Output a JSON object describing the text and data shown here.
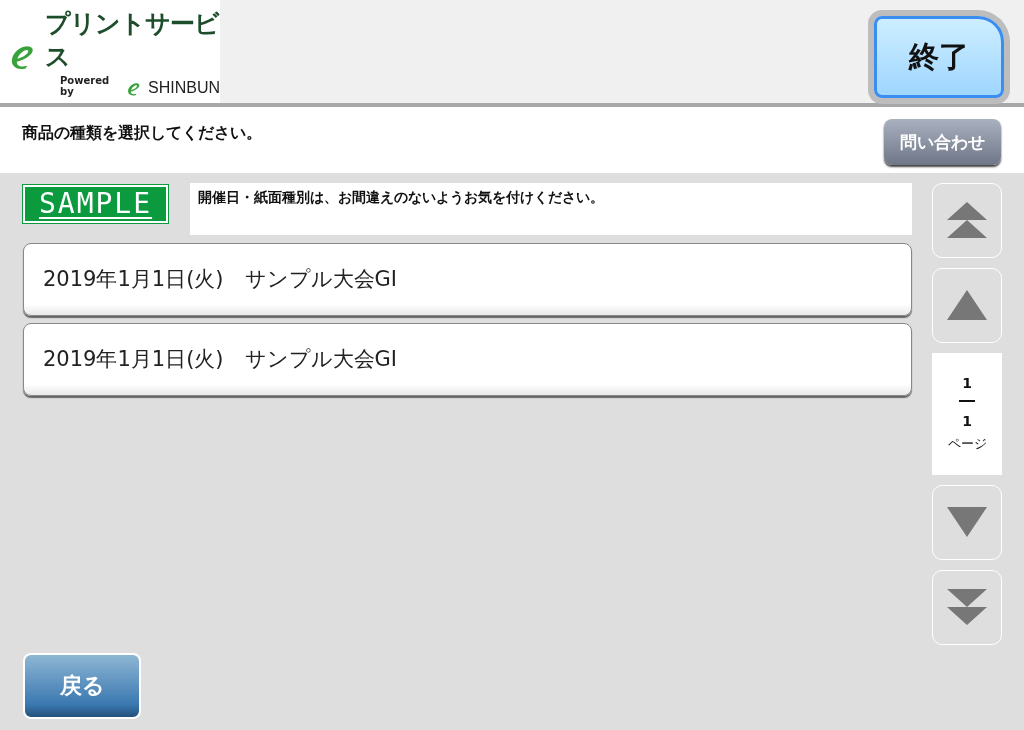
{
  "header": {
    "logo": {
      "service_name": "プリントサービス",
      "powered_by": "Powered by",
      "brand": "SHINBUN"
    },
    "exit_button": "終了"
  },
  "instruction": {
    "text": "商品の種類を選択してください。",
    "contact_button": "問い合わせ"
  },
  "notice": {
    "sample_badge": "SAMPLE",
    "text": "開催日・紙面種別は、お間違えのないようお気を付けください。"
  },
  "items": [
    {
      "label": "2019年1月1日(火)　サンプル大会GI"
    },
    {
      "label": "2019年1月1日(火)　サンプル大会GI"
    }
  ],
  "pager": {
    "buttons": [
      {
        "kind": "first"
      },
      {
        "kind": "prev"
      },
      {
        "kind": "next"
      },
      {
        "kind": "last"
      }
    ],
    "current": "1",
    "total": "1",
    "unit": "ページ"
  },
  "back_button": "戻る"
}
